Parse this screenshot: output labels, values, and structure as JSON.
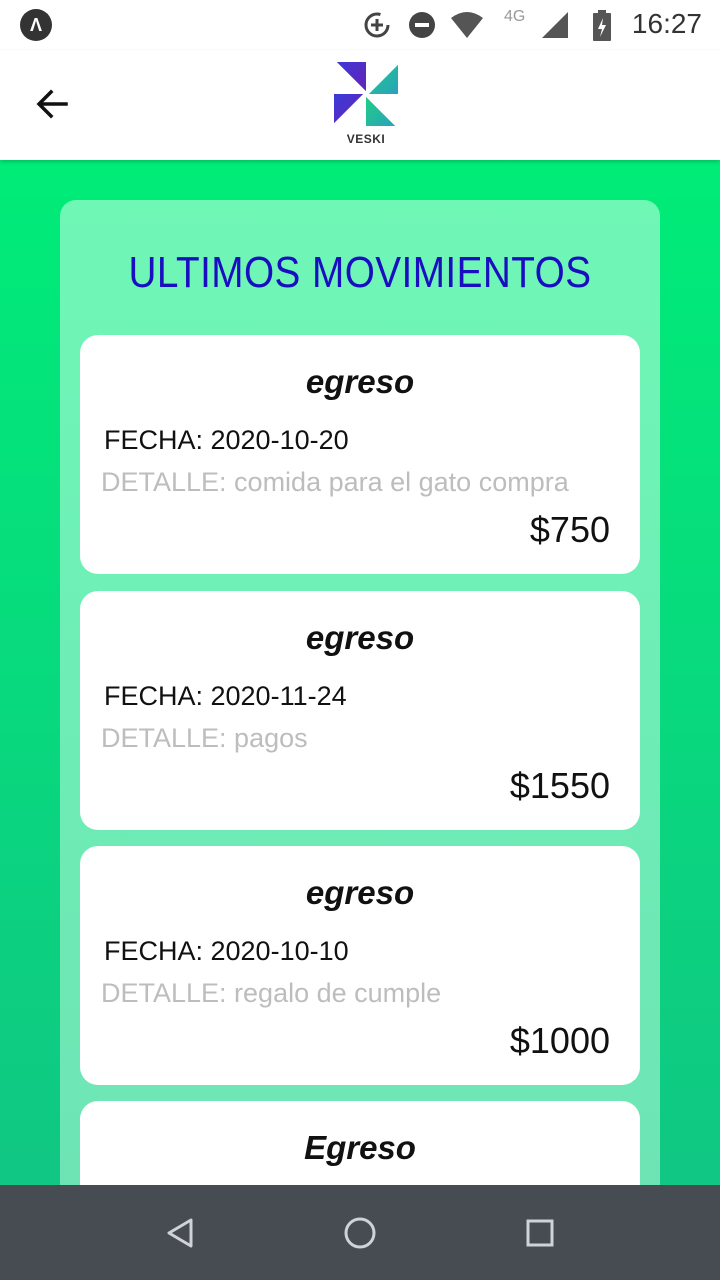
{
  "status_bar": {
    "time": "16:27",
    "network": "4G",
    "app_badge": "Λ"
  },
  "app_bar": {
    "logo_text": "VESKI"
  },
  "panel": {
    "title": "ULTIMOS MOVIMIENTOS"
  },
  "movements": [
    {
      "type": "egreso",
      "date": "FECHA: 2020-10-20",
      "detail": "DETALLE: comida para el gato compra",
      "amount": "$750"
    },
    {
      "type": "egreso",
      "date": "FECHA: 2020-11-24",
      "detail": "DETALLE: pagos",
      "amount": "$1550"
    },
    {
      "type": "egreso",
      "date": "FECHA: 2020-10-10",
      "detail": "DETALLE: regalo de cumple",
      "amount": "$1000"
    },
    {
      "type": "Egreso",
      "date": "",
      "detail": "",
      "amount": ""
    }
  ],
  "colors": {
    "background": "#00e676",
    "title": "#1a0fc0",
    "nav_bar": "#474b52"
  }
}
